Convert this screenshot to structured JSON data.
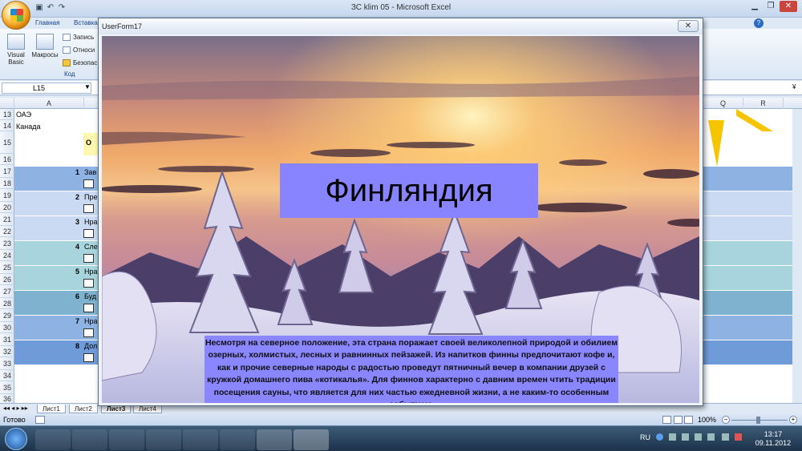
{
  "window": {
    "title": "ЗС klim 05 - Microsoft Excel",
    "minimize_icon": "minimize-icon",
    "maximize_icon": "restore-icon",
    "close_icon": "close-icon"
  },
  "ribbon": {
    "tabs": [
      "Главная",
      "Вставка"
    ],
    "buttons": {
      "visual_basic_line1": "Visual",
      "visual_basic_line2": "Basic",
      "macros": "Макросы",
      "record": "Запись",
      "relative": "Относи",
      "security": "Безопас"
    },
    "group_label": "Код"
  },
  "formula_bar": {
    "name_box": "L15"
  },
  "grid": {
    "columns_left": [
      "A"
    ],
    "columns_right": [
      "Q",
      "R"
    ],
    "rows": [
      "13",
      "14",
      "15",
      "16",
      "17",
      "18",
      "19",
      "20",
      "21",
      "22",
      "23",
      "24",
      "25",
      "26",
      "27",
      "28",
      "29",
      "30",
      "31",
      "32",
      "33",
      "34",
      "35",
      "36"
    ],
    "cells": {
      "a13": "ОАЭ",
      "a14": "Канада",
      "b15": "О"
    },
    "questions": [
      {
        "num": "1",
        "text": "Зав"
      },
      {
        "num": "2",
        "text": "Пре"
      },
      {
        "num": "3",
        "text": "Нра"
      },
      {
        "num": "4",
        "text": "Сле"
      },
      {
        "num": "5",
        "text": "Нра"
      },
      {
        "num": "6",
        "text": "Буд"
      },
      {
        "num": "7",
        "text": "Нра"
      },
      {
        "num": "8",
        "text": "Дол"
      }
    ]
  },
  "sheet_tabs": [
    "Лист1",
    "Лист2",
    "Лист3",
    "Лист4"
  ],
  "status_bar": {
    "state": "Готово",
    "zoom": "100%"
  },
  "taskbar": {
    "language": "RU",
    "time": "13:17",
    "date": "09.11.2012"
  },
  "userform": {
    "title": "UserForm17",
    "close_label": "✕",
    "heading": "Финляндия",
    "description": "Несмотря на северное положение, эта страна поражает своей великолепной природой и обилием озерных, холмистых, лесных и равнинных пейзажей. Из напитков финны предпочитают кофе и, как и прочие северные народы с радостью проведут пятничный вечер в компании друзей с кружкой домашнего пива «котикалья». Для финнов характерно с давним времен чтить традиции посещения сауны, что является для них частью ежедневной жизни, а не каким-то особенным событием."
  },
  "colors": {
    "form_label_bg": "#8884ff",
    "row_band_dark": "#8eb3e3",
    "row_band_light": "#c9daf2",
    "row_band_teal": "#a8d5dd"
  }
}
